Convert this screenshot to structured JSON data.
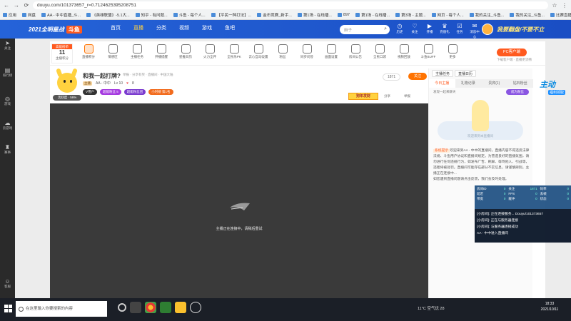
{
  "browser": {
    "url": "douyu.com/101373657_r=0.7124625395208751",
    "bookmarks": [
      "应用",
      "网盘",
      "AA - 中中直播_斗...",
      "《英雄联盟》-5.1大...",
      "知乎 - 有问题...",
      "斗鱼 - 每个人...",
      "【平民一种打法】...",
      "金币竞赛_新手...",
      "第1场 - 在线播...",
      "897",
      "第1场 - 在线播...",
      "第3场 - 主题...",
      "网页 - 每个人...",
      "我的关注_斗鱼...",
      "我的关注_斗鱼...",
      "比赛直播数据..."
    ]
  },
  "header": {
    "event_logo": "2021全明星战",
    "event_badge": "斗鱼",
    "nav": [
      "首页",
      "直播",
      "分类",
      "视频",
      "游戏",
      "鱼吧"
    ],
    "nav_active_index": 1,
    "search_placeholder": "麻子",
    "icons": [
      {
        "icon": "history-icon",
        "label": "历史"
      },
      {
        "icon": "follow-icon",
        "label": "关注"
      },
      {
        "icon": "live-icon",
        "label": "开播"
      },
      {
        "icon": "gift-icon",
        "label": "充值礼"
      },
      {
        "icon": "task-icon",
        "label": "任务"
      },
      {
        "icon": "message-icon",
        "label": "消息中心"
      }
    ],
    "banner_text": "我要翻盘/不要不立"
  },
  "left_sidebar": [
    {
      "icon": "cursor-icon",
      "label": "关注"
    },
    {
      "icon": "list-icon",
      "label": "排行榜"
    },
    {
      "icon": "game-icon",
      "label": "游戏"
    },
    {
      "icon": "cloud-game-icon",
      "label": "云游戏"
    },
    {
      "icon": "trophy-icon",
      "label": "赛事"
    },
    {
      "icon": "service-icon",
      "label": "客服"
    }
  ],
  "category_bar": {
    "rank_badge": {
      "top": "高能榜单",
      "number": "11",
      "sub": "主播积分"
    },
    "items": [
      {
        "icon": "streamer-icon",
        "label": "直播积分"
      },
      {
        "icon": "wave-icon",
        "label": "情感区"
      },
      {
        "icon": "box-icon",
        "label": "主播任务"
      },
      {
        "icon": "clock-icon",
        "label": "开播提醒"
      },
      {
        "icon": "calendar-icon",
        "label": "星推日历"
      },
      {
        "icon": "fire-icon",
        "label": "火力全开"
      },
      {
        "icon": "vote-icon",
        "label": "全民乐PK"
      },
      {
        "icon": "cloud-icon",
        "label": "云心互动设置"
      },
      {
        "icon": "group-icon",
        "label": "粉丝"
      },
      {
        "icon": "sync-icon",
        "label": "同步问答"
      },
      {
        "icon": "gauge-icon",
        "label": "画面设置"
      },
      {
        "icon": "edit-icon",
        "label": "房间公告"
      },
      {
        "icon": "chest-icon",
        "label": "全民口袋"
      },
      {
        "icon": "video-icon",
        "label": "视频回放"
      },
      {
        "icon": "buff-icon",
        "label": "斗鱼BUFF"
      },
      {
        "icon": "more-icon",
        "label": "更多"
      }
    ],
    "pc_client_label": "PC客户端",
    "pc_client_sub": "下载客户端 · 直播更流畅"
  },
  "room": {
    "title": "和我一起打牌?",
    "title_meta": "举报 · 分享有奖 · 直播间 · 中国大陆",
    "host": "AA - 中中",
    "host_tag": "主播",
    "level": "Lv 10",
    "fans": "8",
    "follow_count": "1871",
    "follow_label": "关注",
    "promo": "狗年发财",
    "share": "分享",
    "report": "举报",
    "gauge_label": "活跃度 · 56%",
    "badges": [
      {
        "label": "V用户",
        "color": "#333"
      },
      {
        "label": "超能粉丝 5",
        "color": "#a53ae0"
      },
      {
        "label": "超能粉丝团",
        "color": "#7b3bcf"
      },
      {
        "label": "小时榜 第1名",
        "color": "#f26b1d"
      }
    ]
  },
  "player": {
    "message": "主播正在连接中，请稍后重试"
  },
  "right_panel": {
    "top_buttons": [
      "主播任务",
      "直播日历"
    ],
    "tabs": [
      "今日主播",
      "礼物记录",
      "贵宾(1)",
      "钻石粉丝"
    ],
    "tabs_active_index": 0,
    "caption": "发现一起来聊天",
    "pill": "成为粉丝",
    "art_caption": "欢迎来到本直播间",
    "chat": [
      {
        "sys": "系统提示",
        "text": "欢迎来到AA - 中中的直播间，直播内容不得违反法律法规、斗鱼用户协议和直播间规定。为营造良好的直播氛围，请勿进行任何违规行为，如发布广告、刷屏、辱骂他人、引战等，违者将被处罚。直播间可能存在部分不实信息，请谨慎辨别。主播正在连接中..."
      },
      {
        "sys": "",
        "text": "如您遇到直播问题请点击反馈，我们会及时处理。"
      }
    ]
  },
  "debug": {
    "stats": [
      {
        "k": "房间ID",
        "v": "0"
      },
      {
        "k": "关注",
        "v": "1871"
      },
      {
        "k": "码率",
        "v": "0"
      },
      {
        "k": "延迟",
        "v": "0"
      },
      {
        "k": "FPS",
        "v": "0"
      },
      {
        "k": "丢帧",
        "v": "0"
      },
      {
        "k": "带宽",
        "v": "0"
      },
      {
        "k": "缓冲",
        "v": "0"
      },
      {
        "k": "状态",
        "v": "0"
      }
    ],
    "logs": [
      "[小房间]: 正在连接服务... Douyu/101373657",
      "[小房间]: 正在与服务器连接",
      "[小房间]: 与服务器连接成功",
      "AA - 中中进入直播间"
    ]
  },
  "float_badge": {
    "main": "主动",
    "sub": "福利领取"
  },
  "taskbar": {
    "search_placeholder": "在这里输入你要搜索的内容",
    "weather": "11°C 空气优 28",
    "time": "18:33",
    "date": "2021/10/11"
  }
}
